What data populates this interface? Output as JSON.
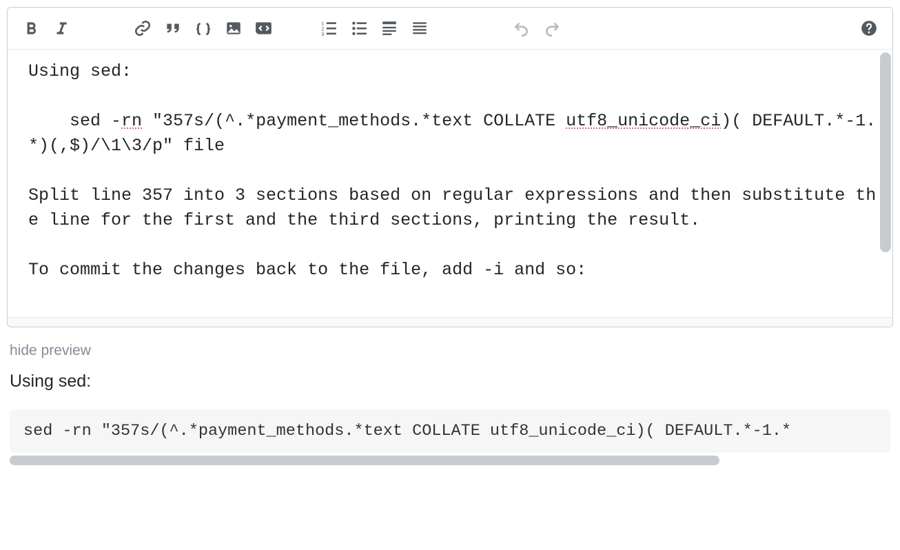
{
  "toolbar": {
    "bold_label": "B",
    "italic_label": "I"
  },
  "editor": {
    "line1": "Using sed:",
    "line2_pre": "    sed -",
    "line2_spell1": "rn",
    "line2_mid": " \"357s/(^.*payment_methods.*text COLLATE ",
    "line2_spell2": "utf8_unicode_ci",
    "line2_post": ")( DEFAULT.*-1.*)(,$)/\\1\\3/p\" file",
    "line3": "Split line 357 into 3 sections based on regular expressions and then substitute the line for the first and the third sections, printing the result.",
    "line4": "To commit the changes back to the file, add -i and so:"
  },
  "preview": {
    "hide_label": "hide preview",
    "heading": "Using sed:",
    "code": "sed -rn \"357s/(^.*payment_methods.*text COLLATE utf8_unicode_ci)( DEFAULT.*-1.*"
  }
}
